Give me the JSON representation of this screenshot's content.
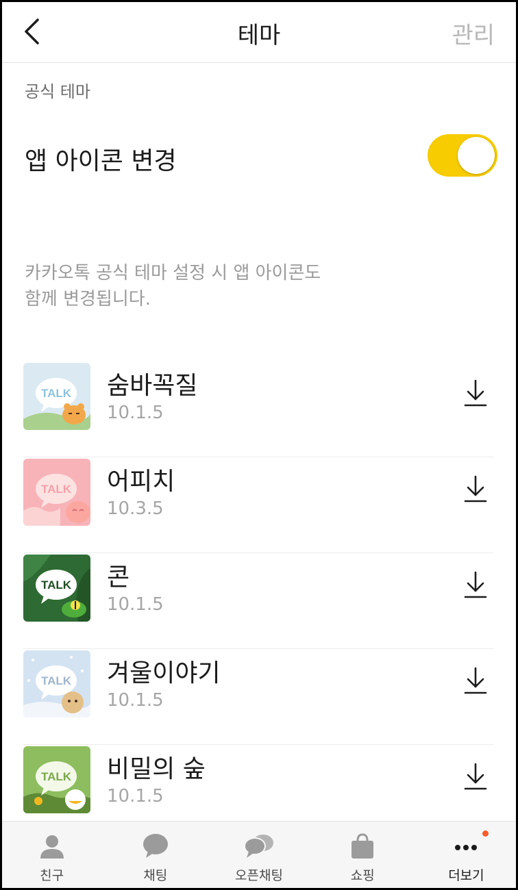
{
  "header": {
    "title": "테마",
    "manage_label": "관리"
  },
  "section_label": "공식 테마",
  "app_icon_toggle": {
    "label": "앱 아이콘 변경",
    "enabled": true
  },
  "description": "카카오톡 공식 테마 설정 시 앱 아이콘도\n함께 변경됩니다.",
  "thumbnail_text": "TALK",
  "themes": [
    {
      "name": "숨바꼭질",
      "version": "10.1.5",
      "thumb_bg": "#dbeaf2",
      "accent": "#f2a84a"
    },
    {
      "name": "어피치",
      "version": "10.3.5",
      "thumb_bg": "#f7b3b8",
      "accent": "#fba7a0"
    },
    {
      "name": "콘",
      "version": "10.1.5",
      "thumb_bg": "#2e6a33",
      "accent": "#4fae3b"
    },
    {
      "name": "겨울이야기",
      "version": "10.1.5",
      "thumb_bg": "#d4e3f2",
      "accent": "#e4c089"
    },
    {
      "name": "비밀의 숲",
      "version": "10.1.5",
      "thumb_bg": "#8dbd5e",
      "accent": "#f2b820"
    }
  ],
  "bottom_nav": [
    {
      "label": "친구",
      "icon": "person-icon"
    },
    {
      "label": "채팅",
      "icon": "chat-bubble-icon"
    },
    {
      "label": "오픈채팅",
      "icon": "open-chat-icon"
    },
    {
      "label": "쇼핑",
      "icon": "shopping-bag-icon"
    },
    {
      "label": "더보기",
      "icon": "more-dots-icon",
      "active": true,
      "badge": true
    }
  ],
  "colors": {
    "toggle_on": "#f7cc00",
    "badge": "#fa5a2a",
    "icon_gray": "#9b9b9b"
  }
}
